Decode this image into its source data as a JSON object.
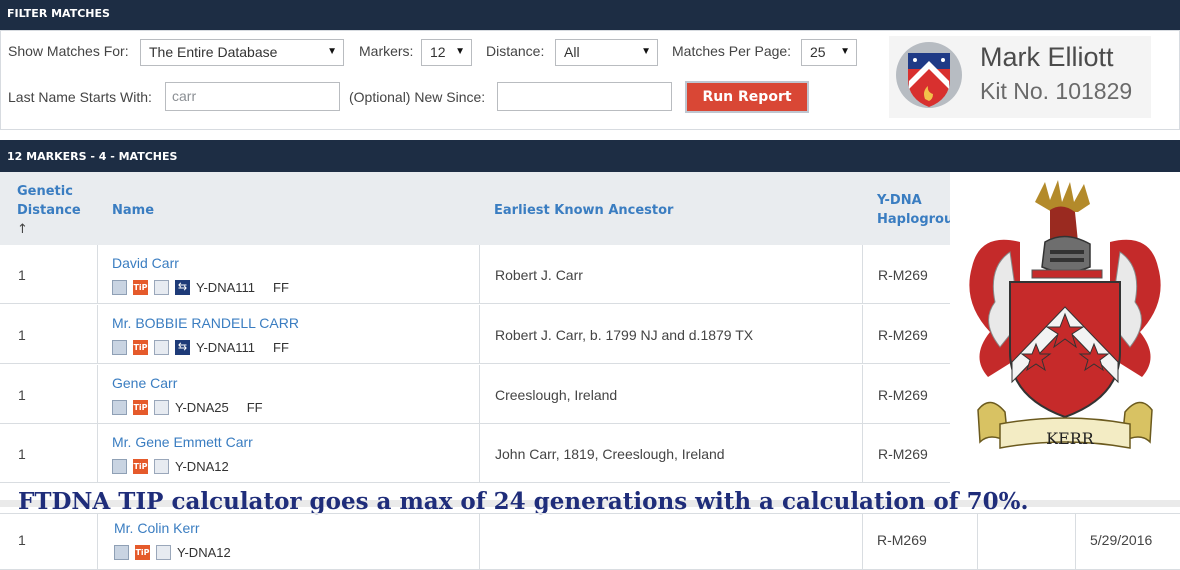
{
  "filter": {
    "title": "FILTER MATCHES",
    "show_label": "Show Matches For:",
    "show_value": "The Entire Database",
    "markers_label": "Markers:",
    "markers_value": "12",
    "distance_label": "Distance:",
    "distance_value": "All",
    "per_page_label": "Matches Per Page:",
    "per_page_value": "25",
    "lastname_label": "Last Name Starts With:",
    "lastname_value": "carr",
    "new_since_label": "(Optional) New Since:",
    "new_since_value": "",
    "run_button": "Run Report"
  },
  "profile": {
    "name": "Mark Elliott",
    "kit": "Kit No. 101829"
  },
  "results": {
    "title": "12 MARKERS - 4 - MATCHES",
    "headers": {
      "genetic_distance": [
        "Genetic",
        "Distance",
        "↑"
      ],
      "name": "Name",
      "ancestor": "Earliest Known Ancestor",
      "haplogroup": [
        "Y-DNA",
        "Haplogrou"
      ]
    },
    "rows": [
      {
        "distance": "1",
        "name": "David Carr",
        "test": "Y-DNA111",
        "flag": "FF",
        "ancestor": "Robert J. Carr",
        "haplogroup": "R-M269"
      },
      {
        "distance": "1",
        "name": "Mr. BOBBIE RANDELL CARR",
        "test": "Y-DNA111",
        "flag": "FF",
        "ancestor": "Robert J. Carr, b. 1799 NJ and d.1879 TX",
        "haplogroup": "R-M269"
      },
      {
        "distance": "1",
        "name": "Gene Carr",
        "test": "Y-DNA25",
        "flag": "FF",
        "ancestor": "Creeslough, Ireland",
        "haplogroup": "R-M269"
      },
      {
        "distance": "1",
        "name": "Mr. Gene Emmett Carr",
        "test": "Y-DNA12",
        "flag": "",
        "ancestor": "John Carr, 1819, Creeslough, Ireland",
        "haplogroup": "R-M269"
      }
    ],
    "last_row": {
      "distance": "1",
      "name": "Mr. Colin Kerr",
      "test": "Y-DNA12",
      "haplogroup": "R-M269",
      "date": "5/29/2016"
    }
  },
  "crest": {
    "scroll_text": "KERR"
  },
  "caption": "FTDNA TIP calculator goes a max of 24 generations with a calculation of 70%.",
  "colors": {
    "header_bar": "#1d2d44",
    "link": "#3a7dc1",
    "run_button": "#d94735",
    "caption": "#1f2d7a"
  }
}
